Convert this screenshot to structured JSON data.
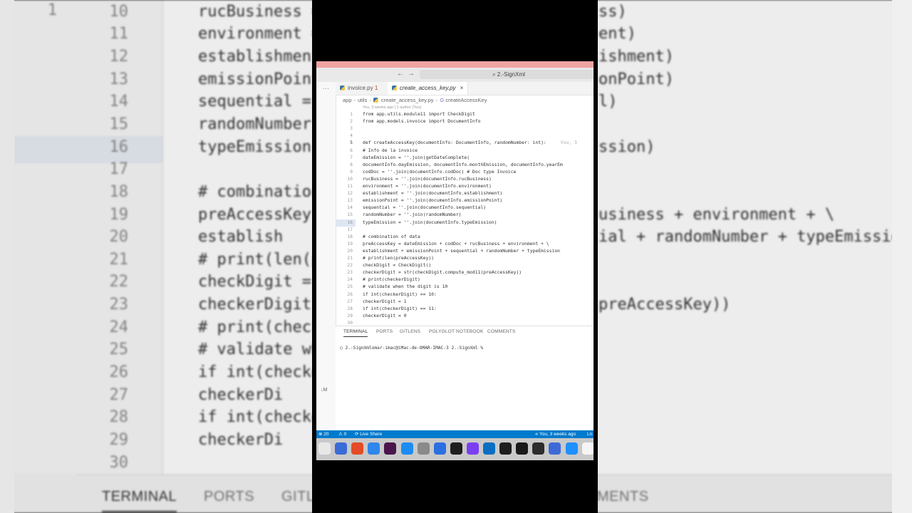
{
  "bg": {
    "lines": [
      {
        "n": "1",
        "code": ""
      },
      {
        "n": "10",
        "code": "rucBusiness =",
        "right": "ss)"
      },
      {
        "n": "11",
        "code": "environment =",
        "right": "ent)"
      },
      {
        "n": "12",
        "code": "establishment",
        "right": "ishment)"
      },
      {
        "n": "13",
        "code": "emissionPoint",
        "right": "onPoint)"
      },
      {
        "n": "14",
        "code": "sequential =",
        "right": "l)"
      },
      {
        "n": "15",
        "code": "randomNumber",
        "right": ""
      },
      {
        "n": "16",
        "code": "typeEmission",
        "right": "ssion)"
      },
      {
        "n": "17",
        "code": ""
      },
      {
        "n": "18",
        "code": "# combination"
      },
      {
        "n": "19",
        "code": "preAccessKey",
        "right": "usiness + environment + \\"
      },
      {
        "n": "20",
        "code": "    establish",
        "right": "ial + randomNumber + typeEmission"
      },
      {
        "n": "21",
        "code": "# print(len(p"
      },
      {
        "n": "22",
        "code": "checkDigit ="
      },
      {
        "n": "23",
        "code": "checkerDigit",
        "right": "preAccessKey))"
      },
      {
        "n": "24",
        "code": "# print(check"
      },
      {
        "n": "25",
        "code": "# validate wh"
      },
      {
        "n": "26",
        "code": "if int(checke"
      },
      {
        "n": "27",
        "code": "    checkerDi"
      },
      {
        "n": "28",
        "code": "if int(checke"
      },
      {
        "n": "29",
        "code": "    checkerDi"
      },
      {
        "n": "30",
        "code": ""
      }
    ],
    "panel_tabs": [
      "TERMINAL",
      "PORTS",
      "GITL",
      "MENTS"
    ]
  },
  "window": {
    "command_center": "⌕ 2.-SignXml",
    "nav_back": "←",
    "nav_forward": "→",
    "activity_dots": "···",
    "activity_badge": "↓M",
    "tabs": [
      {
        "label": "invoice.py",
        "badge": "1",
        "active": false
      },
      {
        "label": "create_access_key.py",
        "active": true
      }
    ],
    "tab_close": "×",
    "breadcrumbs": [
      "app",
      "utils",
      "create_access_key.py",
      "createAccessKey"
    ],
    "blame_header": "You, 3 weeks ago | 1 author (You)",
    "code_lines": [
      {
        "n": "1",
        "code": "from app.utils.module11 import CheckDigit"
      },
      {
        "n": "2",
        "code": "from app.models.invoice import DocumentInfo"
      },
      {
        "n": "3",
        "code": ""
      },
      {
        "n": "4",
        "code": ""
      },
      {
        "n": "5",
        "code": "def createAccessKey(documentInfo: DocumentInfo, randomNumber: int):",
        "blame": "You, 3"
      },
      {
        "n": "6",
        "code": "    # Info de la invoice"
      },
      {
        "n": "7",
        "code": "    dateEmission = ''.join(getDateComplete("
      },
      {
        "n": "8",
        "code": "        documentInfo.dayEmission, documentInfo.monthEmission, documentInfo.yearEm"
      },
      {
        "n": "9",
        "code": "    codDoc = ''.join(documentInfo.codDoc)  # Doc type Invoice"
      },
      {
        "n": "10",
        "code": "    rucBusiness = ''.join(documentInfo.rucBusiness)"
      },
      {
        "n": "11",
        "code": "    environment = ''.join(documentInfo.environment)"
      },
      {
        "n": "12",
        "code": "    establishment = ''.join(documentInfo.establishment)"
      },
      {
        "n": "13",
        "code": "    emissionPoint = ''.join(documentInfo.emissionPoint)"
      },
      {
        "n": "14",
        "code": "    sequential = ''.join(documentInfo.sequential)"
      },
      {
        "n": "15",
        "code": "    randomNumber = ''.join(randomNumber)"
      },
      {
        "n": "16",
        "code": "    typeEmission = ''.join(documentInfo.typeEmission)"
      },
      {
        "n": "17",
        "code": ""
      },
      {
        "n": "18",
        "code": "    # combination of data"
      },
      {
        "n": "19",
        "code": "    preAccessKey = dateEmission + codDoc + rucBusiness + environment + \\"
      },
      {
        "n": "20",
        "code": "        establishment + emissionPoint + sequential + randomNumber + typeEmission"
      },
      {
        "n": "21",
        "code": "    # print(len(preAccessKey))"
      },
      {
        "n": "22",
        "code": "    checkDigit = CheckDigit()"
      },
      {
        "n": "23",
        "code": "    checkerDigit = str(checkDigit.compute_mod11(preAccessKey))"
      },
      {
        "n": "24",
        "code": "    # print(checkerDigit)"
      },
      {
        "n": "25",
        "code": "    # validate when the digit is 10"
      },
      {
        "n": "26",
        "code": "    if int(checkerDigit) == 10:"
      },
      {
        "n": "27",
        "code": "        checkerDigit = 1"
      },
      {
        "n": "28",
        "code": "    if int(checkerDigit) == 11:"
      },
      {
        "n": "29",
        "code": "        checkerDigit = 0"
      },
      {
        "n": "30",
        "code": ""
      }
    ],
    "panel_tabs": [
      "TERMINAL",
      "PORTS",
      "GITLENS",
      "POLYGLOT NOTEBOOK",
      "COMMENTS"
    ],
    "terminal_prompt": "○ 2.-SignXmlomar-imac@iMac-de-OMAR-IMAC-3 2.-SignXml %",
    "status": {
      "errors": "⊗ 20",
      "warnings": "⚠ 0",
      "live_share": "⟳ Live Share",
      "blame": "⟡ You, 3 weeks ago",
      "position": "Ln"
    },
    "dock_colors": [
      "#e8e8e8",
      "#3a6bd6",
      "#e34c26",
      "#2f86eb",
      "#4a154b",
      "#1c8cf2",
      "#8a8a8a",
      "#2b6fe0",
      "#1e1e1e",
      "#7b3ff2",
      "#0a6fc2",
      "#1e1e1e",
      "#1a1a1a",
      "#2d2d2d",
      "#3e6ad8",
      "#1e90ff",
      "#f5f5f5",
      "#f0c24b"
    ],
    "dock_icons": [
      "launchpad-icon",
      "finder-icon",
      "chrome-icon",
      "safari-icon",
      "slack-icon",
      "appstore-icon",
      "settings-icon",
      "xcode-icon",
      "terminal-icon",
      "figma-icon",
      "vscode-icon",
      "iterm-icon",
      "github-icon",
      "tool-icon",
      "browser-icon",
      "edge-icon",
      "notes-icon",
      "stickies-icon"
    ]
  }
}
